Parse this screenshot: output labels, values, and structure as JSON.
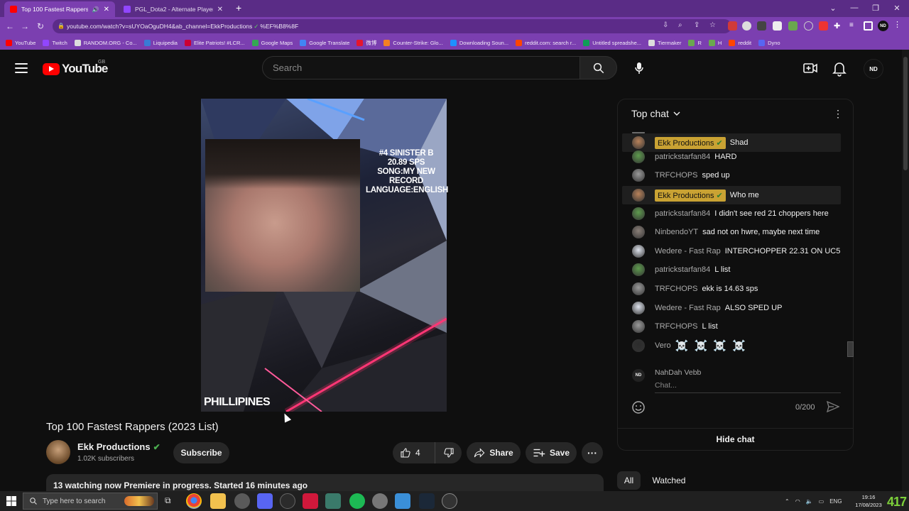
{
  "browser": {
    "tabs": [
      {
        "title": "Top 100 Fastest Rappers (20...",
        "active": true
      },
      {
        "title": "PGL_Dota2 - Alternate Player for...",
        "active": false
      }
    ],
    "url_prefix": "youtube.com/watch?v=sUYOaOguDH4&ab_channel=EkkProductions",
    "url_suffix": "%EF%B8%8F",
    "bookmarks": [
      "YouTube",
      "Twitch",
      "RANDOM.ORG - Co...",
      "Liquipedia",
      "Elite Patriots! #LCR...",
      "Google Maps",
      "Google Translate",
      "微博",
      "Counter-Strike: Glo...",
      "Downloading Soun...",
      "reddit.com: search r...",
      "Untitled spreadshe...",
      "Tiermaker",
      "R",
      "H",
      "reddit",
      "Dyno"
    ],
    "profile_initials": "ND",
    "accent": "#7b3fb0"
  },
  "youtube": {
    "logo_text": "YouTube",
    "country": "GB",
    "search_placeholder": "Search",
    "avatar_initials": "ND"
  },
  "video": {
    "overlay_lines": [
      "#4 SINISTER B",
      "20.89 SPS",
      "SONG:MY NEW RECORD",
      "LANGUAGE:ENGLISH"
    ],
    "country_text": "PHILLIPINES",
    "title": "Top 100 Fastest Rappers (2023 List)",
    "channel_name": "Ekk Productions",
    "subscribers": "1.02K subscribers",
    "subscribe_label": "Subscribe",
    "likes": "4",
    "share_label": "Share",
    "save_label": "Save",
    "description_line": "13 watching now  Premiere in progress. Started 16 minutes ago"
  },
  "chat": {
    "header": "Top chat",
    "messages": [
      {
        "author": "Ekk Productions",
        "text": "Shad",
        "owner": true,
        "avatar_color": "#b8825a"
      },
      {
        "author": "patrickstarfan84",
        "text": "HARD",
        "owner": false,
        "avatar_color": "#5e9b4e"
      },
      {
        "author": "TRFCHOPS",
        "text": "sped up",
        "owner": false,
        "avatar_color": "#9a9a9a"
      },
      {
        "author": "Ekk Productions",
        "text": "Who me",
        "owner": true,
        "avatar_color": "#b8825a"
      },
      {
        "author": "patrickstarfan84",
        "text": "I didn't see red 21 choppers here",
        "owner": false,
        "avatar_color": "#5e9b4e"
      },
      {
        "author": "NinbendoYT",
        "text": "sad not on hwre, maybe next time",
        "owner": false,
        "avatar_color": "#8a7f78"
      },
      {
        "author": "Wedere - Fast Rap",
        "text": "INTERCHOPPER 22.31 ON UC5",
        "owner": false,
        "avatar_color": "#dfe4ee"
      },
      {
        "author": "patrickstarfan84",
        "text": "L list",
        "owner": false,
        "avatar_color": "#5e9b4e"
      },
      {
        "author": "TRFCHOPS",
        "text": "ekk is 14.63 sps",
        "owner": false,
        "avatar_color": "#9a9a9a"
      },
      {
        "author": "Wedere - Fast Rap",
        "text": "ALSO SPED UP",
        "owner": false,
        "avatar_color": "#dfe4ee"
      },
      {
        "author": "TRFCHOPS",
        "text": "L list",
        "owner": false,
        "avatar_color": "#9a9a9a"
      },
      {
        "author": "Vero",
        "text": "☠️ ☠️ ☠️ ☠️",
        "owner": false,
        "avatar_color": "#2c2c2c"
      }
    ],
    "user_name": "NahDah Vebb",
    "user_initials": "ND",
    "input_placeholder": "Chat...",
    "char_count": "0/200",
    "hide_chat_label": "Hide chat"
  },
  "chips": [
    "All",
    "Watched"
  ],
  "taskbar": {
    "search_placeholder": "Type here to search",
    "language": "ENG",
    "time": "19:16",
    "date": "17/08/2023",
    "overlay_number": "417"
  }
}
